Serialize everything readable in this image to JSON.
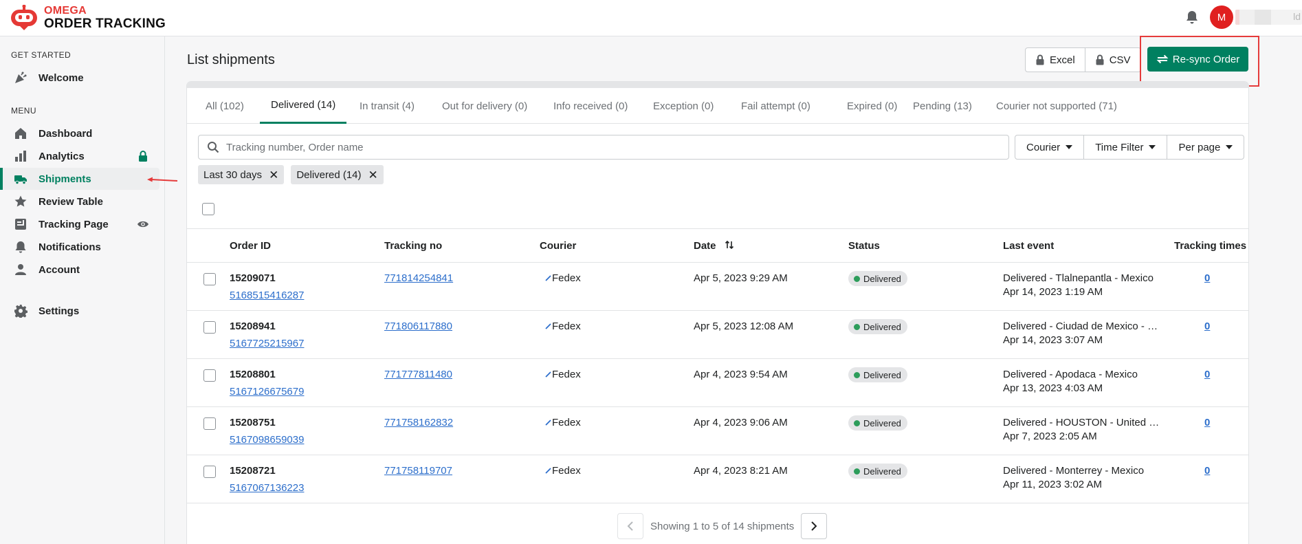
{
  "brand": {
    "top": "OMEGA",
    "bottom": "ORDER TRACKING"
  },
  "user": {
    "initial": "M",
    "name_fragment": "ld"
  },
  "sidebar": {
    "get_started_title": "GET STARTED",
    "menu_title": "MENU",
    "items": [
      {
        "label": "Welcome",
        "icon": "party-icon"
      },
      {
        "label": "Dashboard",
        "icon": "home-icon"
      },
      {
        "label": "Analytics",
        "icon": "bar-chart-icon",
        "badge": "lock-icon"
      },
      {
        "label": "Shipments",
        "icon": "truck-icon",
        "active": true
      },
      {
        "label": "Review Table",
        "icon": "star-icon"
      },
      {
        "label": "Tracking Page",
        "icon": "tracking-page-icon",
        "badge": "eye-icon"
      },
      {
        "label": "Notifications",
        "icon": "bell-icon"
      },
      {
        "label": "Account",
        "icon": "user-icon"
      },
      {
        "label": "Settings",
        "icon": "gear-icon"
      }
    ]
  },
  "page": {
    "title": "List shipments",
    "excel_label": "Excel",
    "csv_label": "CSV",
    "resync_label": "Re-sync Order"
  },
  "tabs": [
    {
      "label": "All (102)"
    },
    {
      "label": "Delivered (14)",
      "active": true
    },
    {
      "label": "In transit (4)"
    },
    {
      "label": "Out for delivery (0)"
    },
    {
      "label": "Info received (0)"
    },
    {
      "label": "Exception (0)"
    },
    {
      "label": "Fail attempt (0)"
    },
    {
      "label": "Expired (0)"
    },
    {
      "label": "Pending (13)"
    },
    {
      "label": "Courier not supported (71)"
    }
  ],
  "search": {
    "placeholder": "Tracking number, Order name",
    "value": ""
  },
  "filters": {
    "courier": "Courier",
    "time": "Time Filter",
    "per_page": "Per page"
  },
  "active_tags": [
    "Last 30 days",
    "Delivered (14)"
  ],
  "table": {
    "headers": {
      "order_id": "Order ID",
      "tracking_no": "Tracking no",
      "courier": "Courier",
      "date": "Date",
      "status": "Status",
      "last_event": "Last event",
      "tracking_times": "Tracking times"
    },
    "rows": [
      {
        "order_id": "15209071",
        "order_name": "5168515416287",
        "tracking_no": "771814254841",
        "courier": "Fedex",
        "date": "Apr 5, 2023 9:29 AM",
        "status": "Delivered",
        "last_event": "Delivered - Tlalnepantla - Mexico",
        "last_event_date": "Apr 14, 2023 1:19 AM",
        "tracking_times": "0"
      },
      {
        "order_id": "15208941",
        "order_name": "5167725215967",
        "tracking_no": "771806117880",
        "courier": "Fedex",
        "date": "Apr 5, 2023 12:08 AM",
        "status": "Delivered",
        "last_event": "Delivered - Ciudad de Mexico - M...",
        "last_event_date": "Apr 14, 2023 3:07 AM",
        "tracking_times": "0"
      },
      {
        "order_id": "15208801",
        "order_name": "5167126675679",
        "tracking_no": "771777811480",
        "courier": "Fedex",
        "date": "Apr 4, 2023 9:54 AM",
        "status": "Delivered",
        "last_event": "Delivered - Apodaca - Mexico",
        "last_event_date": "Apr 13, 2023 4:03 AM",
        "tracking_times": "0"
      },
      {
        "order_id": "15208751",
        "order_name": "5167098659039",
        "tracking_no": "771758162832",
        "courier": "Fedex",
        "date": "Apr 4, 2023 9:06 AM",
        "status": "Delivered",
        "last_event": "Delivered - HOUSTON - United St...",
        "last_event_date": "Apr 7, 2023 2:05 AM",
        "tracking_times": "0"
      },
      {
        "order_id": "15208721",
        "order_name": "5167067136223",
        "tracking_no": "771758119707",
        "courier": "Fedex",
        "date": "Apr 4, 2023 8:21 AM",
        "status": "Delivered",
        "last_event": "Delivered - Monterrey - Mexico",
        "last_event_date": "Apr 11, 2023 3:02 AM",
        "tracking_times": "0"
      }
    ]
  },
  "pagination": {
    "text": "Showing 1 to 5 of 14 shipments"
  },
  "colors": {
    "accent": "#008060",
    "brand_red": "#e53935",
    "link": "#2c6ecb",
    "highlight": "#e53b3b"
  }
}
